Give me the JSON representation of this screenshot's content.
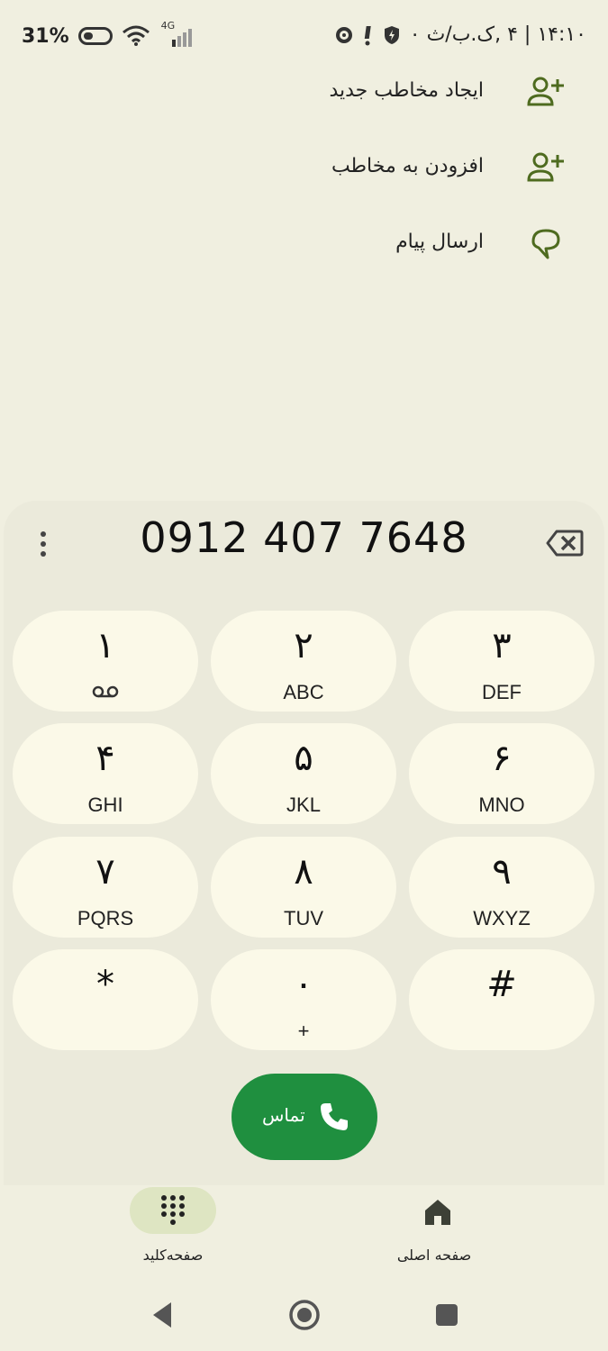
{
  "status_bar": {
    "battery_text": "31%",
    "network": "4G",
    "date_time": "۱۴:۱۰ | ۴ ,ک.ب/ث ۰"
  },
  "actions": [
    {
      "label": "ایجاد مخاطب جدید",
      "icon": "add-person-icon"
    },
    {
      "label": "افزودن به مخاطب",
      "icon": "add-person-icon"
    },
    {
      "label": "ارسال پیام",
      "icon": "message-bubble-icon"
    }
  ],
  "dialer": {
    "number": "0912 407 7648",
    "keys": [
      {
        "digit": "۱",
        "letters": ""
      },
      {
        "digit": "۲",
        "letters": "ABC"
      },
      {
        "digit": "۳",
        "letters": "DEF"
      },
      {
        "digit": "۴",
        "letters": "GHI"
      },
      {
        "digit": "۵",
        "letters": "JKL"
      },
      {
        "digit": "۶",
        "letters": "MNO"
      },
      {
        "digit": "۷",
        "letters": "PQRS"
      },
      {
        "digit": "۸",
        "letters": "TUV"
      },
      {
        "digit": "۹",
        "letters": "WXYZ"
      },
      {
        "digit": "*",
        "letters": ""
      },
      {
        "digit": "۰",
        "letters": "+"
      },
      {
        "digit": "#",
        "letters": ""
      }
    ],
    "call_label": "تماس"
  },
  "bottom_nav": {
    "keypad_label": "صفحه‌کلید",
    "home_label": "صفحه اصلی"
  },
  "colors": {
    "background": "#f0efe0",
    "panel": "#ebeadb",
    "key": "#fbf9e8",
    "call": "#1f8f3f",
    "accent_icon": "#4e6b1f"
  }
}
